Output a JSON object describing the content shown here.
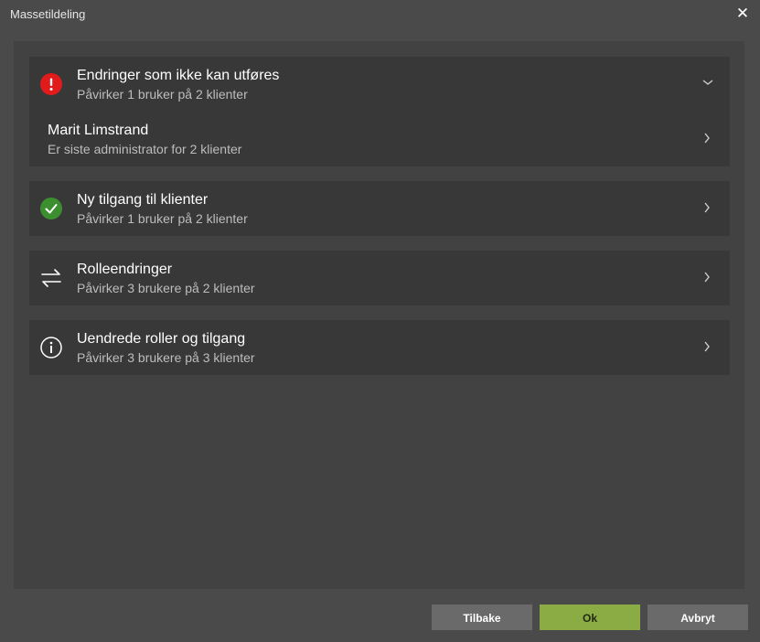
{
  "dialog": {
    "title": "Massetildeling",
    "close_label": "✕"
  },
  "sections": [
    {
      "icon": "error-icon",
      "title": "Endringer som ikke kan utføres",
      "subtitle": "Påvirker 1 bruker på 2 klienter",
      "expanded": true,
      "children": [
        {
          "title": "Marit Limstrand",
          "subtitle": "Er siste administrator for 2 klienter"
        }
      ]
    },
    {
      "icon": "check-icon",
      "title": "Ny tilgang til klienter",
      "subtitle": "Påvirker 1 bruker på 2 klienter",
      "expanded": false
    },
    {
      "icon": "swap-arrows-icon",
      "title": "Rolleendringer",
      "subtitle": "Påvirker 3 brukere på 2 klienter",
      "expanded": false
    },
    {
      "icon": "info-icon",
      "title": "Uendrede roller og tilgang",
      "subtitle": "Påvirker 3 brukere på 3 klienter",
      "expanded": false
    }
  ],
  "footer": {
    "back_label": "Tilbake",
    "ok_label": "Ok",
    "cancel_label": "Avbryt"
  },
  "colors": {
    "error": "#e11b1b",
    "success": "#3b8f2f",
    "primary_button": "#8bab45"
  }
}
